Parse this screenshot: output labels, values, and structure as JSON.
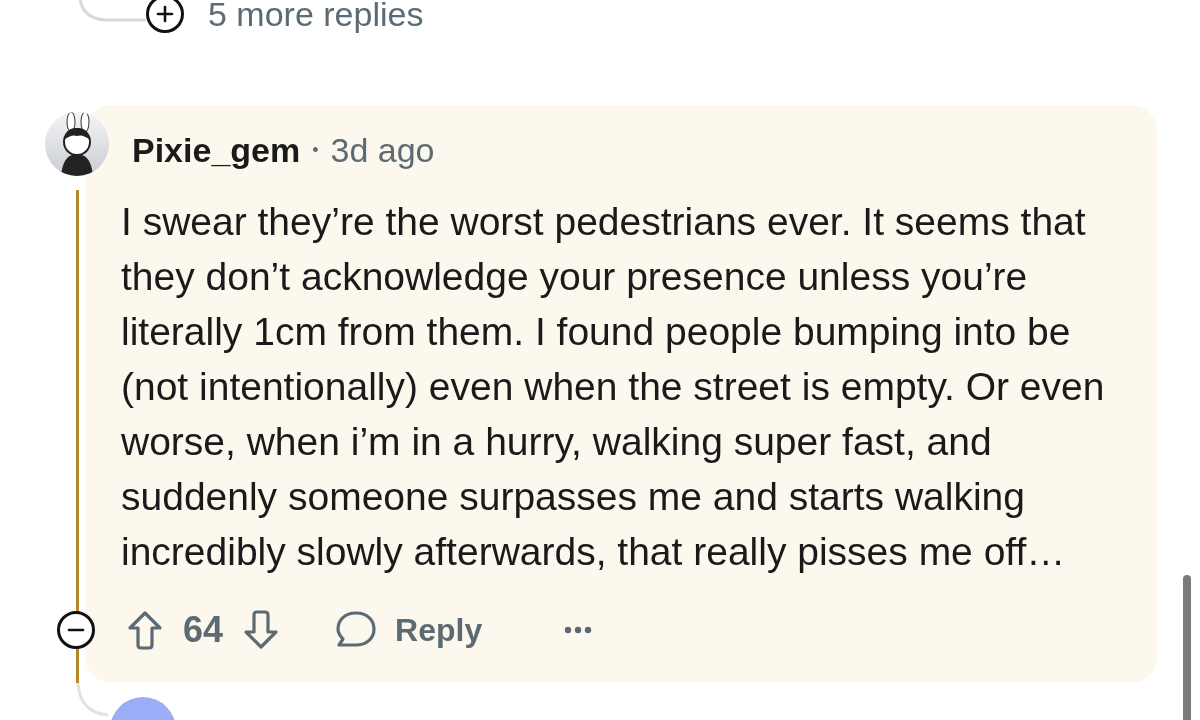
{
  "more_replies": {
    "expanded": false,
    "label": "5 more replies"
  },
  "comment": {
    "author": "Pixie_gem",
    "separator": "•",
    "time": "3d ago",
    "body": "I swear they’re the worst pedestrians ever. It seems that they don’t acknowledge your presence unless you’re literally 1cm from them. I found people bumping into be (not intentionally) even when the street is empty. Or even worse, when i’m in a hurry, walking super fast, and suddenly someone surpasses me and starts walking incredibly slowly afterwards, that really pisses me off…",
    "expanded": true,
    "score": "64",
    "reply_label": "Reply"
  }
}
